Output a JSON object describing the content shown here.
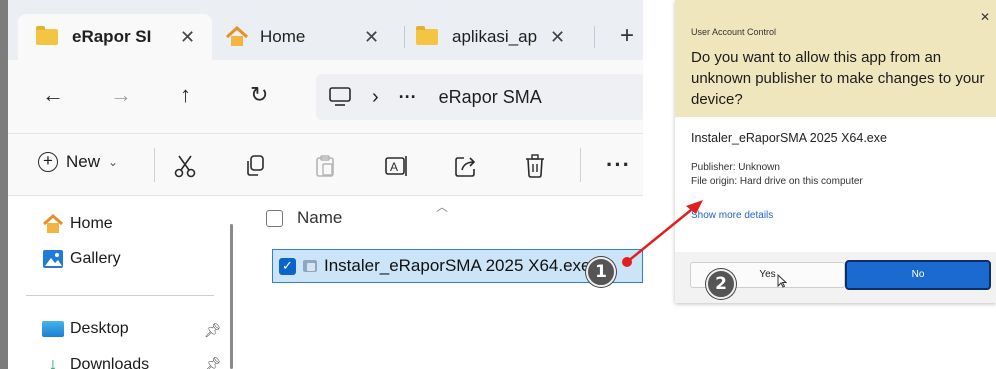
{
  "explorer": {
    "tabs": [
      {
        "label": "eRapor SI",
        "close": "✕"
      },
      {
        "label": "Home",
        "close": "✕"
      },
      {
        "label": "aplikasi_ap",
        "close": "✕"
      }
    ],
    "new_tab": "+",
    "nav": {
      "back": "←",
      "forward": "→",
      "up": "↑",
      "refresh": "↻"
    },
    "address": {
      "separator": "›",
      "more": "···",
      "path": "eRapor SMA"
    },
    "toolbar": {
      "new_label": "New",
      "new_chevron": "⌄",
      "more": "···"
    },
    "sidebar": {
      "items": [
        {
          "label": "Home"
        },
        {
          "label": "Gallery"
        },
        {
          "label": "Desktop"
        },
        {
          "label": "Downloads"
        }
      ]
    },
    "list": {
      "column_name": "Name",
      "files": [
        {
          "name": "Instaler_eRaporSMA 2025 X64.exe",
          "selected": true
        }
      ]
    }
  },
  "uac": {
    "caption": "User Account Control",
    "close": "✕",
    "question": "Do you want to allow this app from an unknown publisher to make changes to your device?",
    "app_name": "Instaler_eRaporSMA 2025 X64.exe",
    "publisher": "Publisher: Unknown",
    "origin": "File origin: Hard drive on this computer",
    "more_details": "Show more details",
    "yes_label": "Yes",
    "no_label": "No"
  },
  "annotations": {
    "step1": "1",
    "step2": "2",
    "arrow_color": "#e02020"
  },
  "colors": {
    "uac_header_bg": "#f0e6bd",
    "no_button_bg": "#1a6ad0",
    "selection_bg": "#cce4f7",
    "selection_border": "#2c7ed8"
  }
}
